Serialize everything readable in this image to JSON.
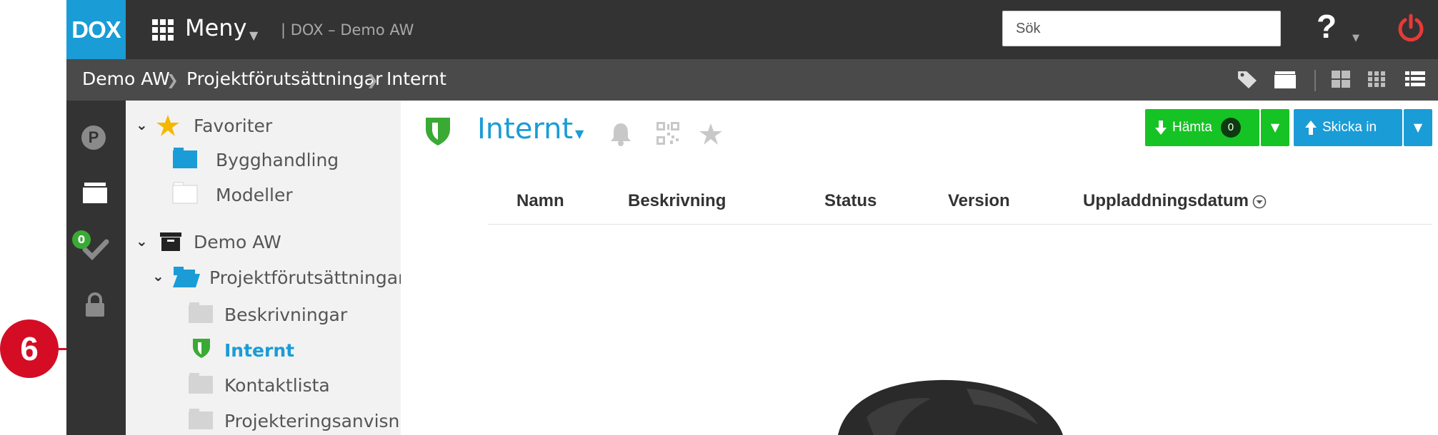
{
  "callout": {
    "number": "6"
  },
  "app": {
    "logo_text": "DOX",
    "menu_label": "Meny",
    "context": "| DOX – Demo AW",
    "search": {
      "placeholder": "Sök"
    },
    "help_label": "?"
  },
  "breadcrumb": [
    "Demo AW",
    "Projektförutsättningar",
    "Internt"
  ],
  "rail": {
    "tasks_badge": "0"
  },
  "tree": {
    "favorites_label": "Favoriter",
    "favorites": [
      "Bygghandling",
      "Modeller"
    ],
    "project_label": "Demo AW",
    "folder_label": "Projektförutsättningar",
    "children": [
      "Beskrivningar",
      "Internt",
      "Kontaktlista",
      "Projekteringsanvisn…"
    ]
  },
  "content": {
    "title": "Internt",
    "hamta_label": "Hämta",
    "hamta_count": "0",
    "skicka_label": "Skicka in",
    "columns": [
      "Namn",
      "Beskrivning",
      "Status",
      "Version",
      "Uppladdningsdatum"
    ]
  },
  "colors": {
    "brand_blue": "#1a9cd6",
    "green_button": "#16c324",
    "dark_bar": "#333333",
    "callout_red": "#d40d25",
    "power_red": "#e63a3a"
  },
  "icons": [
    "apps-grid-icon",
    "chevron-down-icon",
    "help-icon",
    "power-icon",
    "tag-icon",
    "folder-icon",
    "grid-large-icon",
    "grid-small-icon",
    "list-icon",
    "parking-icon",
    "checkmark-icon",
    "lock-icon",
    "star-icon",
    "archive-box-icon",
    "folder-open-icon",
    "shield-icon",
    "bell-icon",
    "qr-code-icon",
    "download-icon",
    "upload-icon",
    "sort-icon"
  ]
}
